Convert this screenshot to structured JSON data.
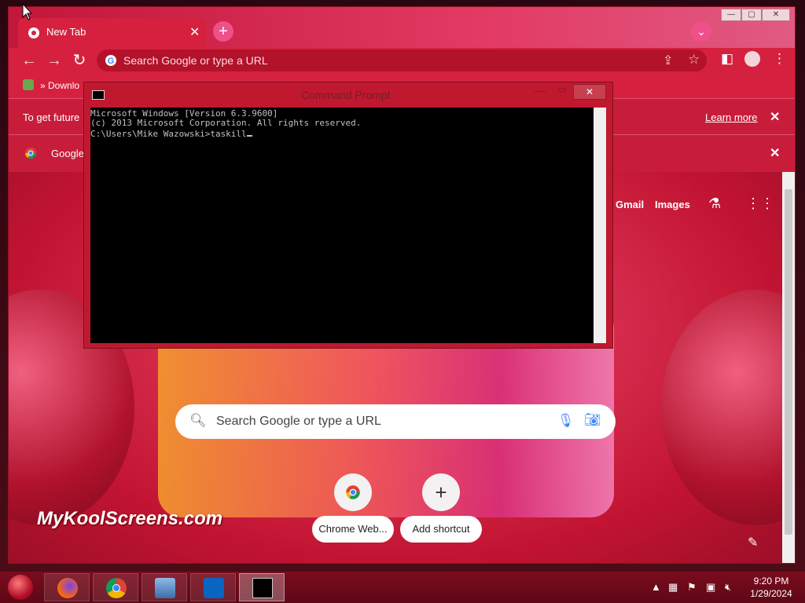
{
  "browser": {
    "tab_title": "New Tab",
    "new_tab": "+",
    "omnibox_placeholder": "Search Google or type a URL",
    "bookmarks_label": "» Downlo",
    "info1_text": "To get future",
    "info1_link": "Learn more",
    "info2_text": "Google",
    "ntp_links": {
      "gmail": "Gmail",
      "images": "Images"
    },
    "search_placeholder": "Search Google or type a URL",
    "shortcuts": [
      {
        "label": "Chrome Web..."
      },
      {
        "label": "Add shortcut",
        "symbol": "+"
      }
    ],
    "watermark": "MyKoolScreens.com"
  },
  "cmd": {
    "title": "Command Prompt",
    "lines": [
      "Microsoft Windows [Version 6.3.9600]",
      "(c) 2013 Microsoft Corporation. All rights reserved.",
      "",
      "C:\\Users\\Mike Wazowski>taskill"
    ]
  },
  "taskbar": {
    "time": "9:20 PM",
    "date": "1/29/2024",
    "apps": [
      "firefox-icon",
      "chrome-icon",
      "control-panel-icon",
      "outlook-icon",
      "command-prompt-icon"
    ]
  },
  "colors": {
    "theme_red": "#c81d3a",
    "console_bg": "#000000",
    "console_text": "#c0c0c0"
  }
}
